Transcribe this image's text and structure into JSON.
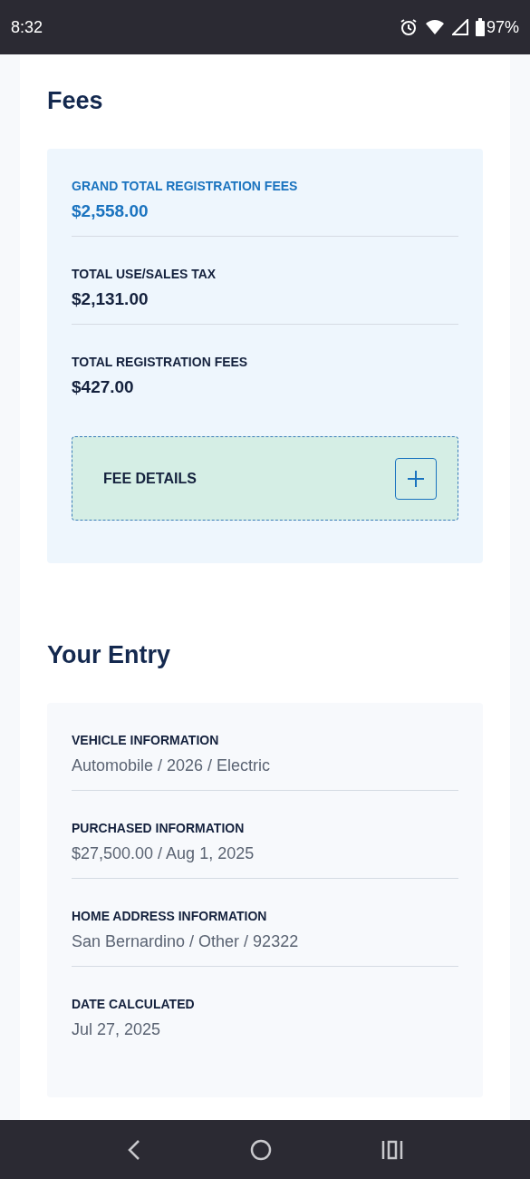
{
  "status_bar": {
    "time": "8:32",
    "battery": "97%"
  },
  "fees": {
    "title": "Fees",
    "items": [
      {
        "kind": "grand_total",
        "label": "GRAND TOTAL REGISTRATION FEES",
        "value": "$2,558.00"
      },
      {
        "kind": "total",
        "label": "TOTAL USE/SALES TAX",
        "value": "$2,131.00"
      },
      {
        "kind": "total",
        "label": "TOTAL REGISTRATION FEES",
        "value": "$427.00"
      }
    ],
    "details": {
      "label": "FEE DETAILS",
      "expanded": false
    }
  },
  "entry": {
    "title": "Your Entry",
    "items": [
      {
        "label": "VEHICLE INFORMATION",
        "value": "Automobile / 2026 / Electric"
      },
      {
        "label": "PURCHASED INFORMATION",
        "value": "$27,500.00 / Aug 1, 2025"
      },
      {
        "label": "HOME ADDRESS INFORMATION",
        "value": "San Bernardino / Other / 92322"
      },
      {
        "label": "DATE CALCULATED",
        "value": "Jul 27, 2025"
      }
    ]
  }
}
